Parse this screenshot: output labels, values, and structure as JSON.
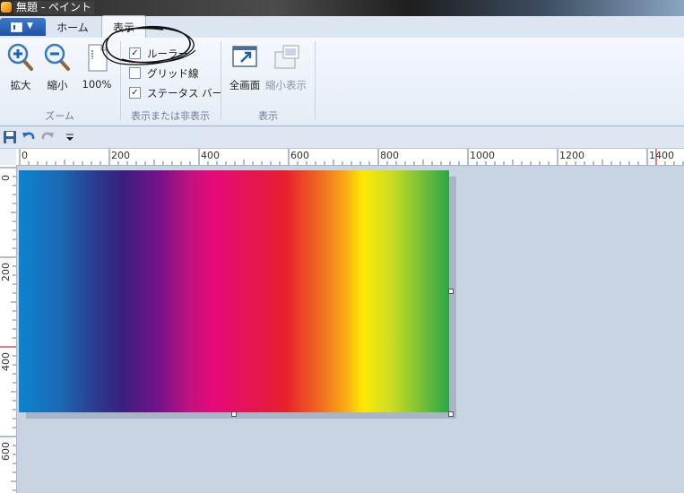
{
  "window": {
    "title": "無題 - ペイント"
  },
  "tabs": {
    "home": "ホーム",
    "view": "表示"
  },
  "ribbon": {
    "zoom": {
      "zoom_in": "拡大",
      "zoom_out": "縮小",
      "actual": "100%",
      "group_label": "ズーム"
    },
    "show_hide": {
      "rulers": {
        "label": "ルーラー",
        "checked": true
      },
      "gridlines": {
        "label": "グリッド線",
        "checked": false
      },
      "statusbar": {
        "label": "ステータス バー",
        "checked": true
      },
      "group_label": "表示または非表示"
    },
    "display": {
      "fullscreen": "全画面",
      "thumbnail": "縮小表示",
      "group_label": "表示"
    }
  },
  "rulers": {
    "horizontal": [
      "0",
      "200",
      "400",
      "600",
      "800",
      "1000",
      "1200",
      "1400"
    ],
    "vertical": [
      "0",
      "200",
      "400",
      "600"
    ]
  },
  "colors": {
    "accent": "#2b64b6",
    "ruler_marker": "#c00000"
  },
  "icons": [
    "app-menu-icon",
    "zoom-in-icon",
    "zoom-out-icon",
    "actual-size-icon",
    "fullscreen-icon",
    "thumbnail-icon",
    "save-icon",
    "undo-icon",
    "redo-icon",
    "customize-dropdown-icon"
  ]
}
